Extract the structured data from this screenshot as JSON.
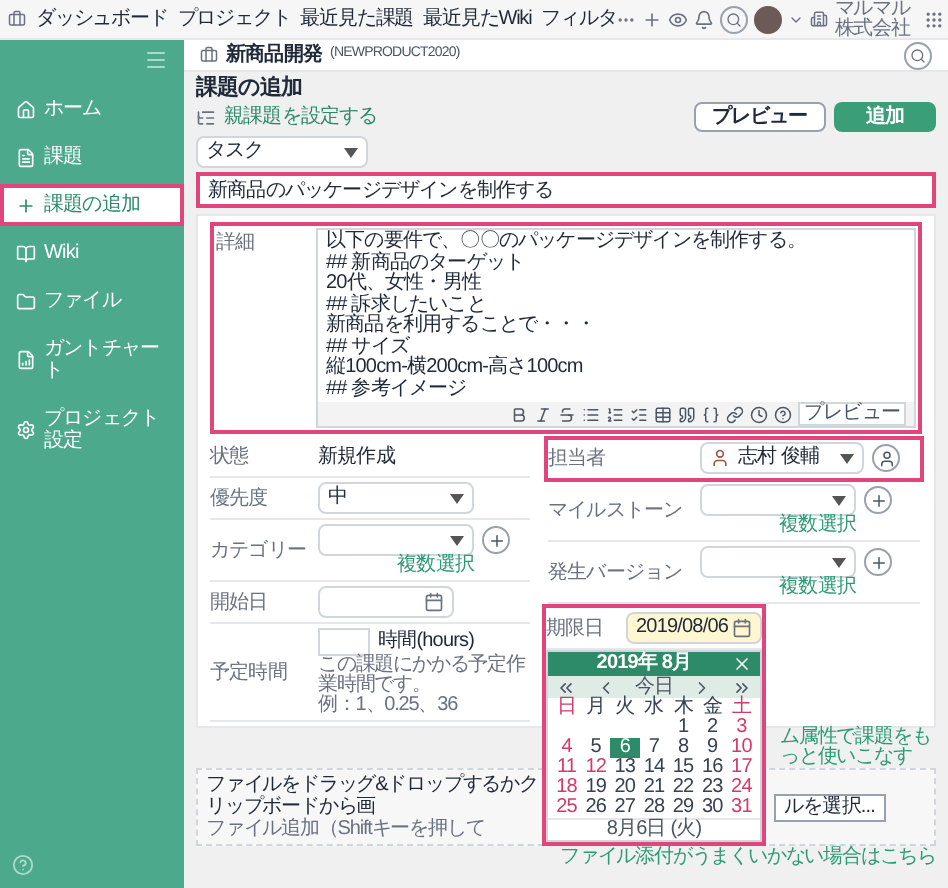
{
  "top_nav": {
    "items": [
      "ダッシュボード",
      "プロジェクト",
      "最近見た課題",
      "最近見たWiki",
      "フィルタ"
    ],
    "company": "マルマル株式会社"
  },
  "sidebar": {
    "items": [
      {
        "label": "ホーム",
        "selected": false
      },
      {
        "label": "課題",
        "selected": false
      },
      {
        "label": "課題の追加",
        "selected": true
      },
      {
        "label": "Wiki",
        "selected": false
      },
      {
        "label": "ファイル",
        "selected": false
      },
      {
        "label": "ガントチャート",
        "selected": false
      },
      {
        "label": "プロジェクト設定",
        "selected": false
      }
    ]
  },
  "project": {
    "name": "新商品開発",
    "key": "(NEWPRODUCT2020)"
  },
  "page_title": "課題の追加",
  "parent_link": "親課題を設定する",
  "buttons": {
    "preview": "プレビュー",
    "add": "追加"
  },
  "issue_type": "タスク",
  "summary": {
    "value": "新商品のパッケージデザインを制作する",
    "highlighted": true
  },
  "description": {
    "label": "詳細",
    "highlighted": true,
    "paragraphs": [
      [
        "以下の要件で、〇〇のパッケージデザインを制作する。"
      ],
      [
        "## 新商品のターゲット",
        "20代、女性・男性"
      ],
      [
        "## 訴求したいこと",
        "新商品を利用することで・・・"
      ],
      [
        "## サイズ",
        "縦100cm-横200cm-高さ100cm"
      ],
      [
        "## 参考イメージ"
      ]
    ],
    "preview": "プレビュー"
  },
  "left_fields": [
    {
      "kind": "text",
      "label": "状態",
      "value": "新規作成"
    },
    {
      "kind": "select",
      "label": "優先度",
      "value": "中"
    },
    {
      "kind": "multi",
      "label": "カテゴリー",
      "multi_link": "複数選択"
    },
    {
      "kind": "date",
      "label": "開始日"
    },
    {
      "kind": "hours",
      "label": "予定時間",
      "unit": "時間(hours)",
      "help": [
        "この課題にかかる予定作業時間です。",
        "例：1、0.25、36"
      ]
    }
  ],
  "right_fields": [
    {
      "kind": "user",
      "label": "担当者",
      "value": "志村 俊輔",
      "highlighted": true
    },
    {
      "kind": "multi",
      "label": "マイルストーン",
      "multi_link": "複数選択",
      "highlighted": false
    },
    {
      "kind": "multi",
      "label": "発生バージョン",
      "multi_link": "複数選択",
      "highlighted": false
    },
    {
      "kind": "date",
      "label": "期限日",
      "value": "2019/08/06",
      "highlighted": true
    }
  ],
  "calendar": {
    "title": "2019年 8月",
    "today": "今日",
    "weekdays": [
      {
        "label": "日",
        "holiday": true
      },
      {
        "label": "月",
        "holiday": false
      },
      {
        "label": "火",
        "holiday": false
      },
      {
        "label": "水",
        "holiday": false
      },
      {
        "label": "木",
        "holiday": false
      },
      {
        "label": "金",
        "holiday": false
      },
      {
        "label": "土",
        "holiday": true
      }
    ],
    "weeks": [
      [
        {
          "kind": "blank"
        },
        {
          "kind": "blank"
        },
        {
          "kind": "blank"
        },
        {
          "kind": "blank"
        },
        {
          "kind": "day",
          "label": "1",
          "holiday": false,
          "selected": false
        },
        {
          "kind": "day",
          "label": "2",
          "holiday": false,
          "selected": false
        },
        {
          "kind": "day",
          "label": "3",
          "holiday": true,
          "selected": false
        }
      ],
      [
        {
          "kind": "day",
          "label": "4",
          "holiday": true,
          "selected": false
        },
        {
          "kind": "day",
          "label": "5",
          "holiday": false,
          "selected": false
        },
        {
          "kind": "day",
          "label": "6",
          "holiday": false,
          "selected": true
        },
        {
          "kind": "day",
          "label": "7",
          "holiday": false,
          "selected": false
        },
        {
          "kind": "day",
          "label": "8",
          "holiday": false,
          "selected": false
        },
        {
          "kind": "day",
          "label": "9",
          "holiday": false,
          "selected": false
        },
        {
          "kind": "day",
          "label": "10",
          "holiday": true,
          "selected": false
        }
      ],
      [
        {
          "kind": "day",
          "label": "11",
          "holiday": true,
          "selected": false
        },
        {
          "kind": "day",
          "label": "12",
          "holiday": true,
          "selected": false
        },
        {
          "kind": "day",
          "label": "13",
          "holiday": false,
          "selected": false
        },
        {
          "kind": "day",
          "label": "14",
          "holiday": false,
          "selected": false
        },
        {
          "kind": "day",
          "label": "15",
          "holiday": false,
          "selected": false
        },
        {
          "kind": "day",
          "label": "16",
          "holiday": false,
          "selected": false
        },
        {
          "kind": "day",
          "label": "17",
          "holiday": true,
          "selected": false
        }
      ],
      [
        {
          "kind": "day",
          "label": "18",
          "holiday": true,
          "selected": false
        },
        {
          "kind": "day",
          "label": "19",
          "holiday": false,
          "selected": false
        },
        {
          "kind": "day",
          "label": "20",
          "holiday": false,
          "selected": false
        },
        {
          "kind": "day",
          "label": "21",
          "holiday": false,
          "selected": false
        },
        {
          "kind": "day",
          "label": "22",
          "holiday": false,
          "selected": false
        },
        {
          "kind": "day",
          "label": "23",
          "holiday": false,
          "selected": false
        },
        {
          "kind": "day",
          "label": "24",
          "holiday": true,
          "selected": false
        }
      ],
      [
        {
          "kind": "day",
          "label": "25",
          "holiday": true,
          "selected": false
        },
        {
          "kind": "day",
          "label": "26",
          "holiday": false,
          "selected": false
        },
        {
          "kind": "day",
          "label": "27",
          "holiday": false,
          "selected": false
        },
        {
          "kind": "day",
          "label": "28",
          "holiday": false,
          "selected": false
        },
        {
          "kind": "day",
          "label": "29",
          "holiday": false,
          "selected": false
        },
        {
          "kind": "day",
          "label": "30",
          "holiday": false,
          "selected": false
        },
        {
          "kind": "day",
          "label": "31",
          "holiday": true,
          "selected": false
        }
      ]
    ],
    "footer": "8月6日 (火)"
  },
  "custom_field_link": "ム属性で課題をもっと使いこなす",
  "file_drop": {
    "text": "ファイルをドラッグ&ドロップするかクリップボードから画",
    "button": "ルを選択...",
    "hint": "ファイル追加（Shiftキーを押して"
  },
  "help_link": "ファイル添付がうまくいかない場合はこちら"
}
